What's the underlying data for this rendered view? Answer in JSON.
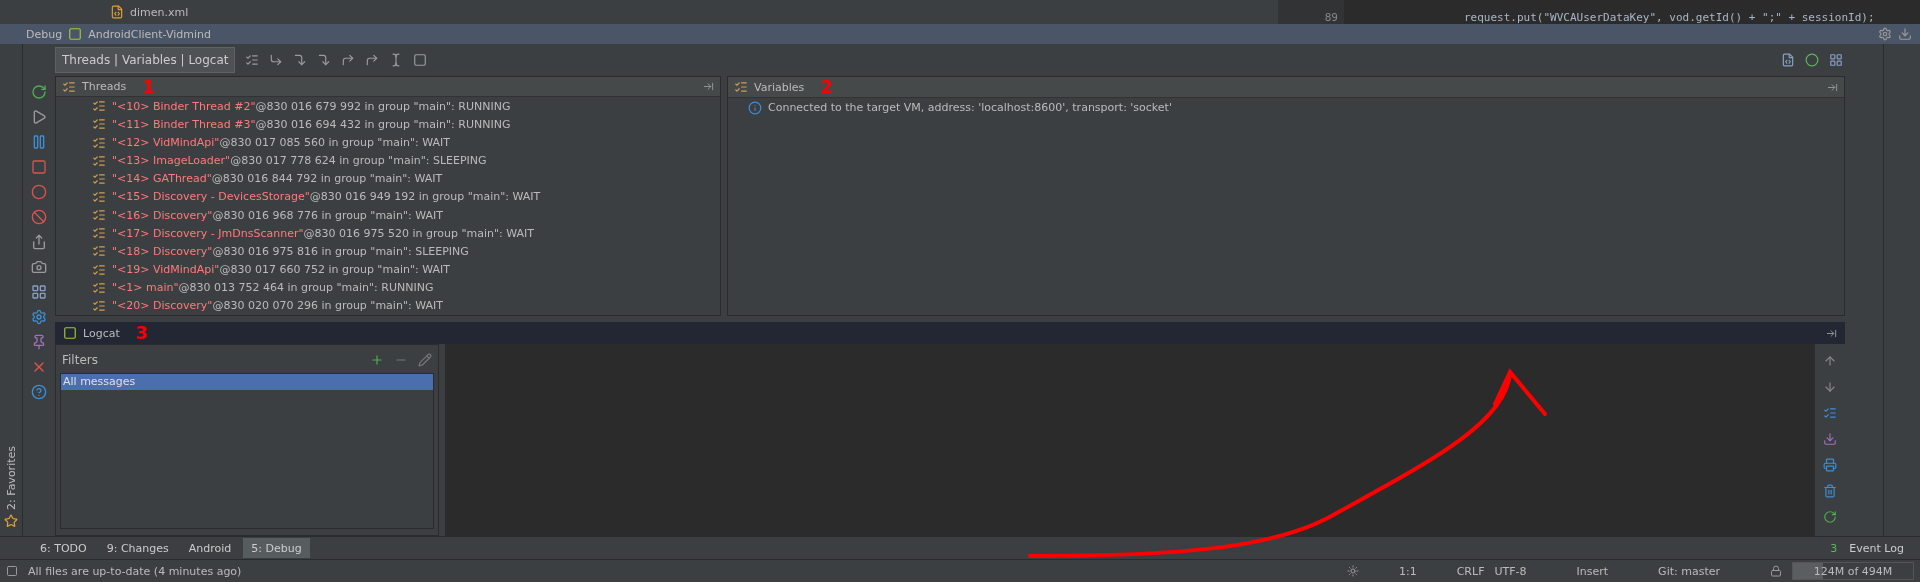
{
  "editor": {
    "file_name": "dimen.xml",
    "lines": [
      {
        "number": "89",
        "code": "request.put(\"WVCAUserDataKey\", vod.getId() + \";\" + sessionId);"
      }
    ]
  },
  "debug_header": {
    "label": "Debug",
    "config": "AndroidClient-Vidmind"
  },
  "toolbar": {
    "tab": "Threads | Variables | Logcat"
  },
  "threads": {
    "title": "Threads",
    "items": [
      {
        "name": "\"<10> Binder Thread #2\"",
        "detail": "@830 016 679 992 in group \"main\": RUNNING"
      },
      {
        "name": "\"<11> Binder Thread #3\"",
        "detail": "@830 016 694 432 in group \"main\": RUNNING"
      },
      {
        "name": "\"<12> VidMindApi\"",
        "detail": "@830 017 085 560 in group \"main\": WAIT"
      },
      {
        "name": "\"<13> ImageLoader\"",
        "detail": "@830 017 778 624 in group \"main\": SLEEPING"
      },
      {
        "name": "\"<14> GAThread\"",
        "detail": "@830 016 844 792 in group \"main\": WAIT"
      },
      {
        "name": "\"<15> Discovery - DevicesStorage\"",
        "detail": "@830 016 949 192 in group \"main\": WAIT"
      },
      {
        "name": "\"<16> Discovery\"",
        "detail": "@830 016 968 776 in group \"main\": WAIT"
      },
      {
        "name": "\"<17> Discovery - JmDnsScanner\"",
        "detail": "@830 016 975 520 in group \"main\": WAIT"
      },
      {
        "name": "\"<18> Discovery\"",
        "detail": "@830 016 975 816 in group \"main\": SLEEPING"
      },
      {
        "name": "\"<19> VidMindApi\"",
        "detail": "@830 017 660 752 in group \"main\": WAIT"
      },
      {
        "name": "\"<1> main\"",
        "detail": "@830 013 752 464 in group \"main\": RUNNING"
      },
      {
        "name": "\"<20> Discovery\"",
        "detail": "@830 020 070 296 in group \"main\": WAIT"
      }
    ]
  },
  "variables": {
    "title": "Variables",
    "message": "Connected to the target VM, address: 'localhost:8600', transport: 'socket'"
  },
  "logcat": {
    "title": "Logcat",
    "filters_label": "Filters",
    "filters": [
      {
        "label": "All messages",
        "selected": true
      }
    ]
  },
  "annotations": [
    "1",
    "2",
    "3"
  ],
  "side_favorites": "2: Favorites",
  "tool_tabs": [
    {
      "label": "6: TODO",
      "selected": false
    },
    {
      "label": "9: Changes",
      "selected": false
    },
    {
      "label": "Android",
      "selected": false
    },
    {
      "label": "5: Debug",
      "selected": true
    }
  ],
  "event_log": {
    "label": "Event Log",
    "count": "3"
  },
  "status_bar": {
    "message": "All files are up-to-date (4 minutes ago)",
    "position": "1:1",
    "line_sep": "CRLF",
    "encoding": "UTF-8",
    "mode": "Insert",
    "vcs": "Git: master",
    "memory": {
      "text": "124M of 494M",
      "level": 0.25
    }
  }
}
